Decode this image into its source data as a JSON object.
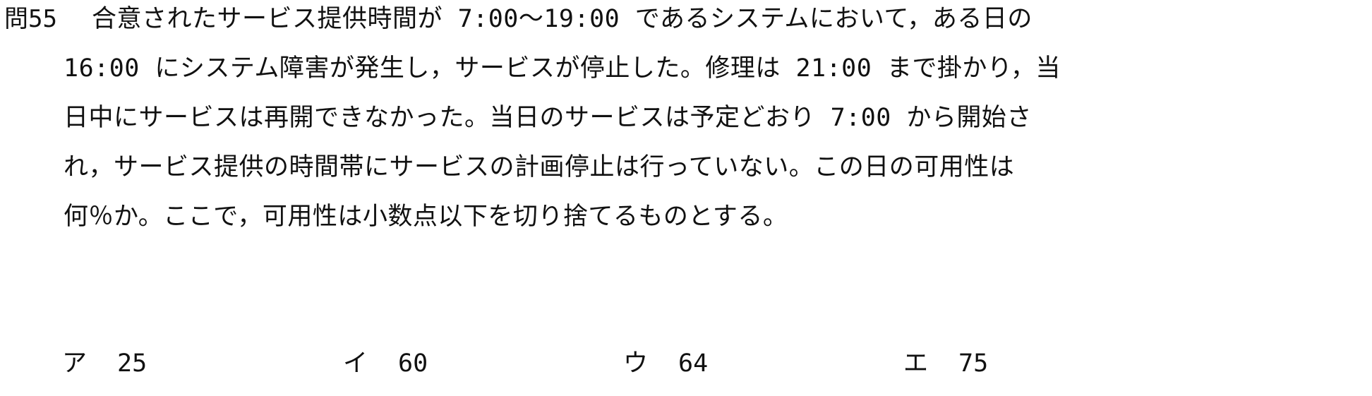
{
  "question": {
    "number": "問55",
    "lines": [
      "合意されたサービス提供時間が 7:00～19:00 であるシステムにおいて，ある日の",
      "16:00 にシステム障害が発生し，サービスが停止した。修理は 21:00 まで掛かり，当",
      "日中にサービスは再開できなかった。当日のサービスは予定どおり 7:00 から開始さ",
      "れ，サービス提供の時間帯にサービスの計画停止は行っていない。この日の可用性は",
      "何％か。ここで，可用性は小数点以下を切り捨てるものとする。"
    ]
  },
  "choices": [
    {
      "mark": "ア",
      "value": "25"
    },
    {
      "mark": "イ",
      "value": "60"
    },
    {
      "mark": "ウ",
      "value": "64"
    },
    {
      "mark": "エ",
      "value": "75"
    }
  ]
}
